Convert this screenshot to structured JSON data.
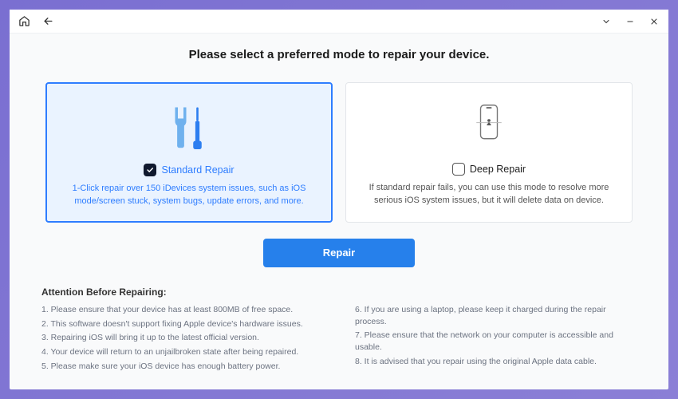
{
  "headline": "Please select a preferred mode to repair your device.",
  "modes": {
    "standard": {
      "title": "Standard Repair",
      "desc": "1-Click repair over 150 iDevices system issues, such as iOS mode/screen stuck, system bugs, update errors, and more.",
      "selected": true
    },
    "deep": {
      "title": "Deep Repair",
      "desc": "If standard repair fails, you can use this mode to resolve more serious iOS system issues, but it will delete data on device.",
      "selected": false
    }
  },
  "primary_button": "Repair",
  "attention": {
    "heading": "Attention Before Repairing:",
    "left": [
      "1. Please ensure that your device has at least 800MB of free space.",
      "2. This software doesn't support fixing Apple device's hardware issues.",
      "3. Repairing iOS will bring it up to the latest official version.",
      "4. Your device will return to an unjailbroken state after being repaired.",
      "5. Please make sure your iOS device has enough battery power."
    ],
    "right": [
      "6. If you are using a laptop, please keep it charged during the repair process.",
      "7. Please ensure that the network on your computer is accessible and usable.",
      "8. It is advised that you repair using the original Apple data cable."
    ]
  },
  "colors": {
    "accent": "#2680eb",
    "selected_border": "#2e7dff",
    "selected_bg": "#eaf3ff"
  }
}
